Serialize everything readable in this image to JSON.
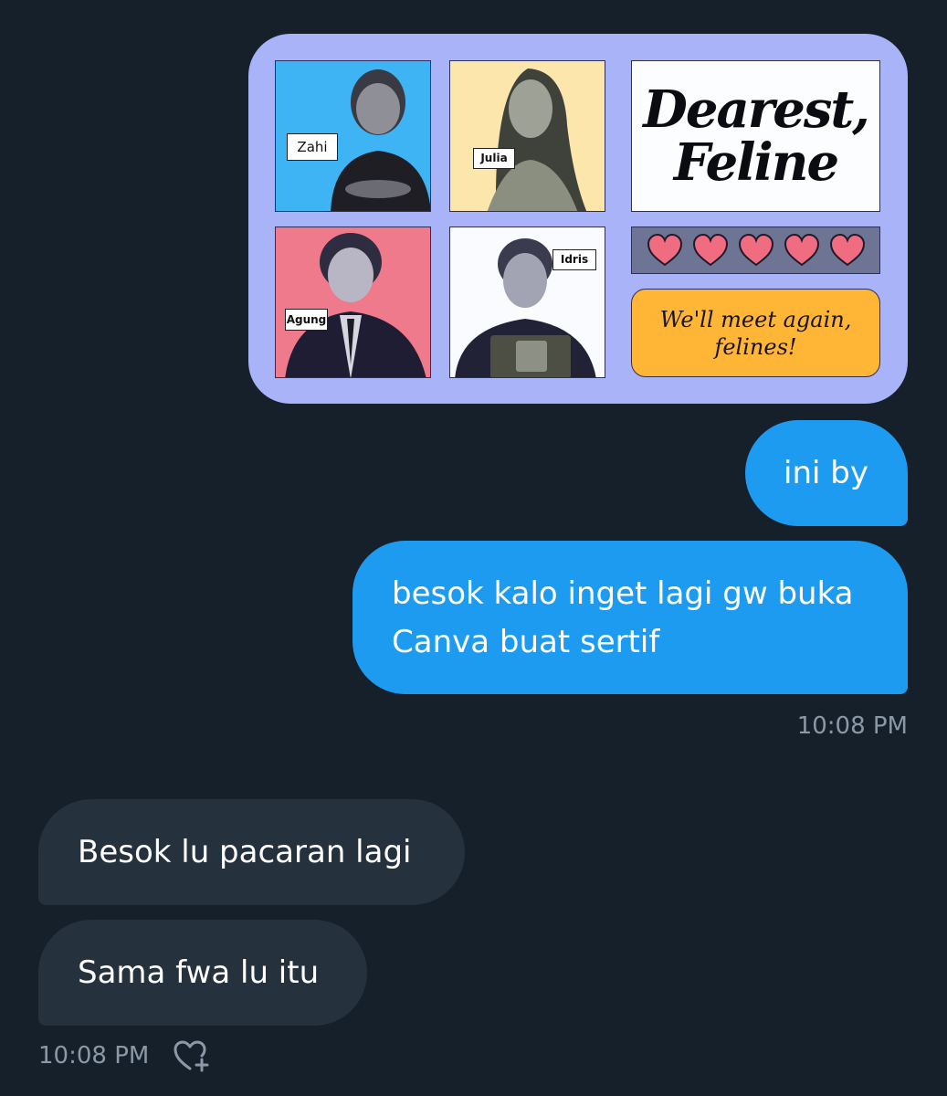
{
  "attachment": {
    "people": [
      {
        "name": "Zahi"
      },
      {
        "name": "Julia"
      },
      {
        "name": "Agung"
      },
      {
        "name": "Idris"
      }
    ],
    "title_line1": "Dearest,",
    "title_line2": "Feline",
    "hearts_count": 5,
    "footer_line1": "We'll meet again,",
    "footer_line2": "felines!",
    "colors": {
      "card": "#a8b3f8",
      "zahi_bg": "#3fb4f5",
      "julia_bg": "#fce6ac",
      "agung_bg": "#ee7a8c",
      "idris_bg": "#fafbff",
      "heart": "#f06c80",
      "footer_bg": "#ffb535"
    }
  },
  "messages": {
    "sent_1": "ini by",
    "sent_2_line1": "besok kalo inget lagi gw buka",
    "sent_2_line2": "Canva buat sertif",
    "sent_time": "10:08 PM",
    "recv_1": "Besok lu pacaran lagi",
    "recv_2": "Sama fwa lu itu",
    "recv_time": "10:08 PM"
  },
  "icons": {
    "react": "heart-plus-icon"
  }
}
